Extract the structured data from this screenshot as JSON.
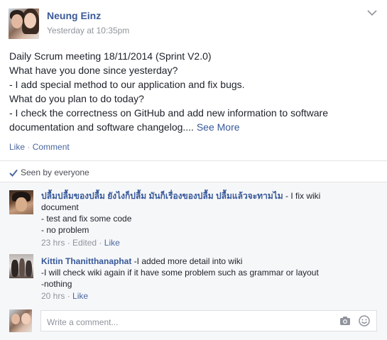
{
  "post": {
    "author": "Neung Einz",
    "timestamp": "Yesterday at 10:35pm",
    "lines": [
      "Daily Scrum meeting 18/11/2014 (Sprint V2.0)",
      "What have you done since yesterday?",
      "- I add special method to our application and fix bugs.",
      "What do you plan to do today?",
      "- I check the correctness on GitHub and add new information to software",
      "documentation and software changelog...."
    ],
    "see_more": "See More",
    "like_label": "Like",
    "separator": "·",
    "comment_label": "Comment",
    "seen_by": "Seen by everyone"
  },
  "comments": [
    {
      "author": "ปลื้มปลื้มของปลื้ม ยังไงก็ปลื้ม มันก็เรื่องของปลื้ม ปลื้มแล้วจะทามไม",
      "text_first": " - I fix wiki",
      "lines": [
        "document",
        "- test and fix some code",
        "- no problem"
      ],
      "time": "23 hrs",
      "edited": "Edited",
      "like_label": "Like"
    },
    {
      "author": "Kittin Thanitthanaphat",
      "text_first": " -I added more detail into wiki",
      "lines": [
        "-I will check wiki again if it have some problem such as grammar or layout",
        "-nothing"
      ],
      "time": "20 hrs",
      "like_label": "Like"
    }
  ],
  "composer": {
    "placeholder": "Write a comment..."
  },
  "icons": {
    "menu": "chevron-down-icon",
    "seen": "checkmark-icon",
    "camera": "camera-icon",
    "emoji": "smiley-icon"
  },
  "colors": {
    "link": "#365899",
    "author": "#3b5998",
    "meta": "#90949c",
    "comments_bg": "#f6f7f9"
  }
}
